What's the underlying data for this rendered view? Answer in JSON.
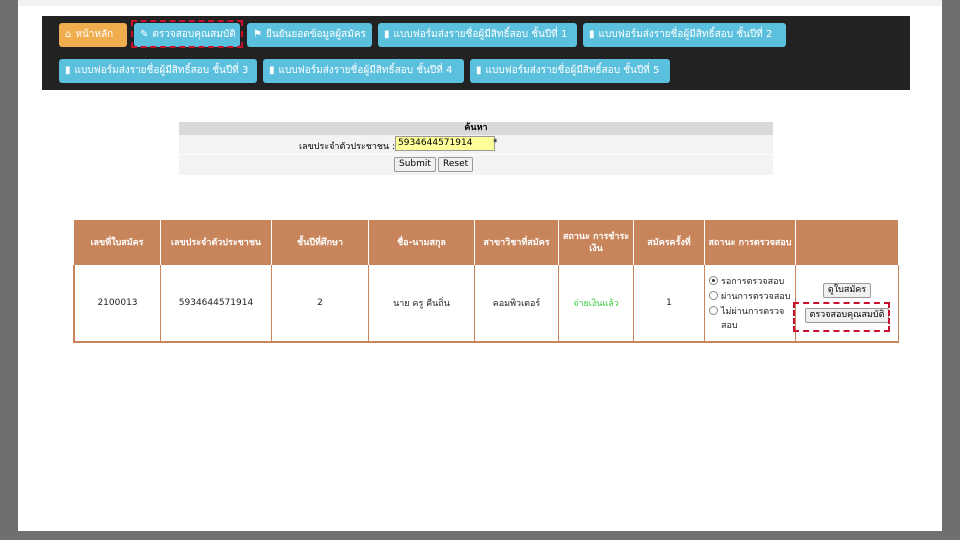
{
  "nav": {
    "home": "หน้าหลัก",
    "check_qualification": "ตรวจสอบคุณสมบัติ",
    "confirm_info": "ยืนยันยอดข้อมูลผู้สมัคร",
    "form_year1": "แบบฟอร์มส่งรายชื่อผู้มีสิทธิ์สอบ ชั้นปีที่ 1",
    "form_year2": "แบบฟอร์มส่งรายชื่อผู้มีสิทธิ์สอบ ชั้นปีที่ 2",
    "form_year3": "แบบฟอร์มส่งรายชื่อผู้มีสิทธิ์สอบ ชั้นปีที่ 3",
    "form_year4": "แบบฟอร์มส่งรายชื่อผู้มีสิทธิ์สอบ ชั้นปีที่ 4",
    "form_year5": "แบบฟอร์มส่งรายชื่อผู้มีสิทธิ์สอบ ชั้นปีที่ 5"
  },
  "search": {
    "title": "ค้นหา",
    "id_label": "เลขประจำตัวประชาชน :",
    "id_value": "5934644571914",
    "required_mark": "*",
    "submit": "Submit",
    "reset": "Reset"
  },
  "table": {
    "headers": [
      "เลขที่ใบสมัคร",
      "เลขประจำตัวประชาชน",
      "ชั้นปีที่ศึกษา",
      "ชื่อ-นามสกุล",
      "สาขาวิชาที่สมัคร",
      "สถานะ การชำระเงิน",
      "สมัครครั้งที่",
      "สถานะ การตรวจสอบ",
      ""
    ],
    "row": {
      "application_no": "2100013",
      "citizen_id": "5934644571914",
      "year": "2",
      "name": "นาย ครู คืนถิ่น",
      "major": "คอมพิวเตอร์",
      "payment_status": "จ่ายเงินแล้ว",
      "attempt": "1",
      "status_options": [
        "รอการตรวจสอบ",
        "ผ่านการตรวจสอบ",
        "ไม่ผ่านการตรวจสอบ"
      ],
      "selected_status": "รอการตรวจสอบ",
      "view_button": "ดูใบสมัคร",
      "check_button": "ตรวจสอบคุณสมบัติ"
    }
  },
  "colors": {
    "nav_bg": "#222222",
    "nav_button": "#5bc0de",
    "home_button": "#f0ad4e",
    "table_header": "#c8845a",
    "paid_text": "#3acb3a",
    "highlight_dash": "#c8102e"
  }
}
